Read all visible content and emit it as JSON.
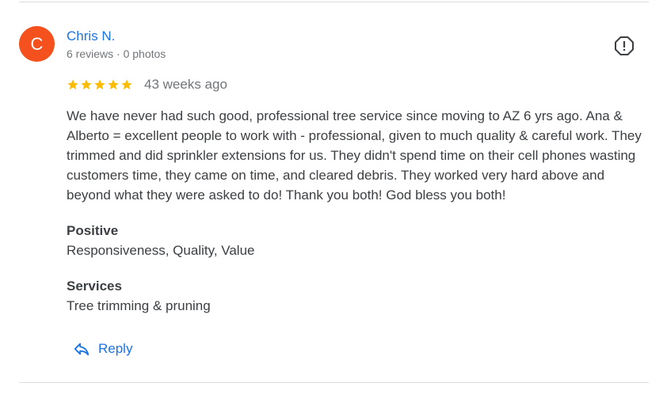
{
  "review": {
    "avatar_letter": "C",
    "avatar_color": "#f4511e",
    "author_name": "Chris N.",
    "author_meta": "6 reviews · 0 photos",
    "rating": 5,
    "rating_max": 5,
    "star_color": "#fbbc04",
    "time_ago": "43 weeks ago",
    "text": "We have never had such good, professional tree service since moving to AZ 6 yrs ago. Ana & Alberto = excellent people to work with - professional, given to much quality & careful work. They trimmed and did sprinkler extensions for us. They didn't spend time on their cell phones wasting customers time, they came on time, and cleared debris. They worked very hard above and beyond what they were asked to do! Thank you both! God bless you both!",
    "positive_label": "Positive",
    "positive_value": "Responsiveness, Quality, Value",
    "services_label": "Services",
    "services_value": "Tree trimming & pruning",
    "reply_label": "Reply",
    "report_icon": "report-icon",
    "reply_icon": "reply-arrow-icon"
  }
}
